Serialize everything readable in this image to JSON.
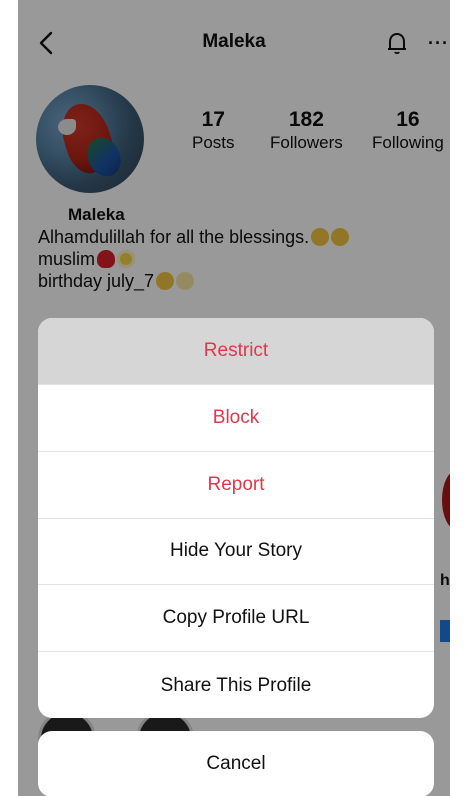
{
  "header": {
    "username": "Maleka",
    "back_icon": "chevron-left-icon",
    "bell_icon": "bell-icon",
    "more_label": "···"
  },
  "profile": {
    "avatar_icon": "parrot-avatar",
    "stats": [
      {
        "value": "17",
        "label": "Posts"
      },
      {
        "value": "182",
        "label": "Followers"
      },
      {
        "value": "16",
        "label": "Following"
      }
    ],
    "display_name": "Maleka",
    "bio_line1": "Alhamdulillah for all the blessings.",
    "bio_line2": "muslim",
    "bio_line3": "birthday july_7",
    "side_peek_text": "h"
  },
  "action_sheet": {
    "items": [
      {
        "label": "Restrict",
        "style": "danger",
        "highlighted": true
      },
      {
        "label": "Block",
        "style": "danger",
        "highlighted": false
      },
      {
        "label": "Report",
        "style": "danger",
        "highlighted": false
      },
      {
        "label": "Hide Your Story",
        "style": "default",
        "highlighted": false
      },
      {
        "label": "Copy Profile URL",
        "style": "default",
        "highlighted": false
      },
      {
        "label": "Share This Profile",
        "style": "default",
        "highlighted": false
      }
    ],
    "cancel_label": "Cancel"
  },
  "colors": {
    "danger": "#e0384a",
    "overlay": "rgba(0,0,0,0.40)",
    "highlight": "#d6d6d6"
  }
}
